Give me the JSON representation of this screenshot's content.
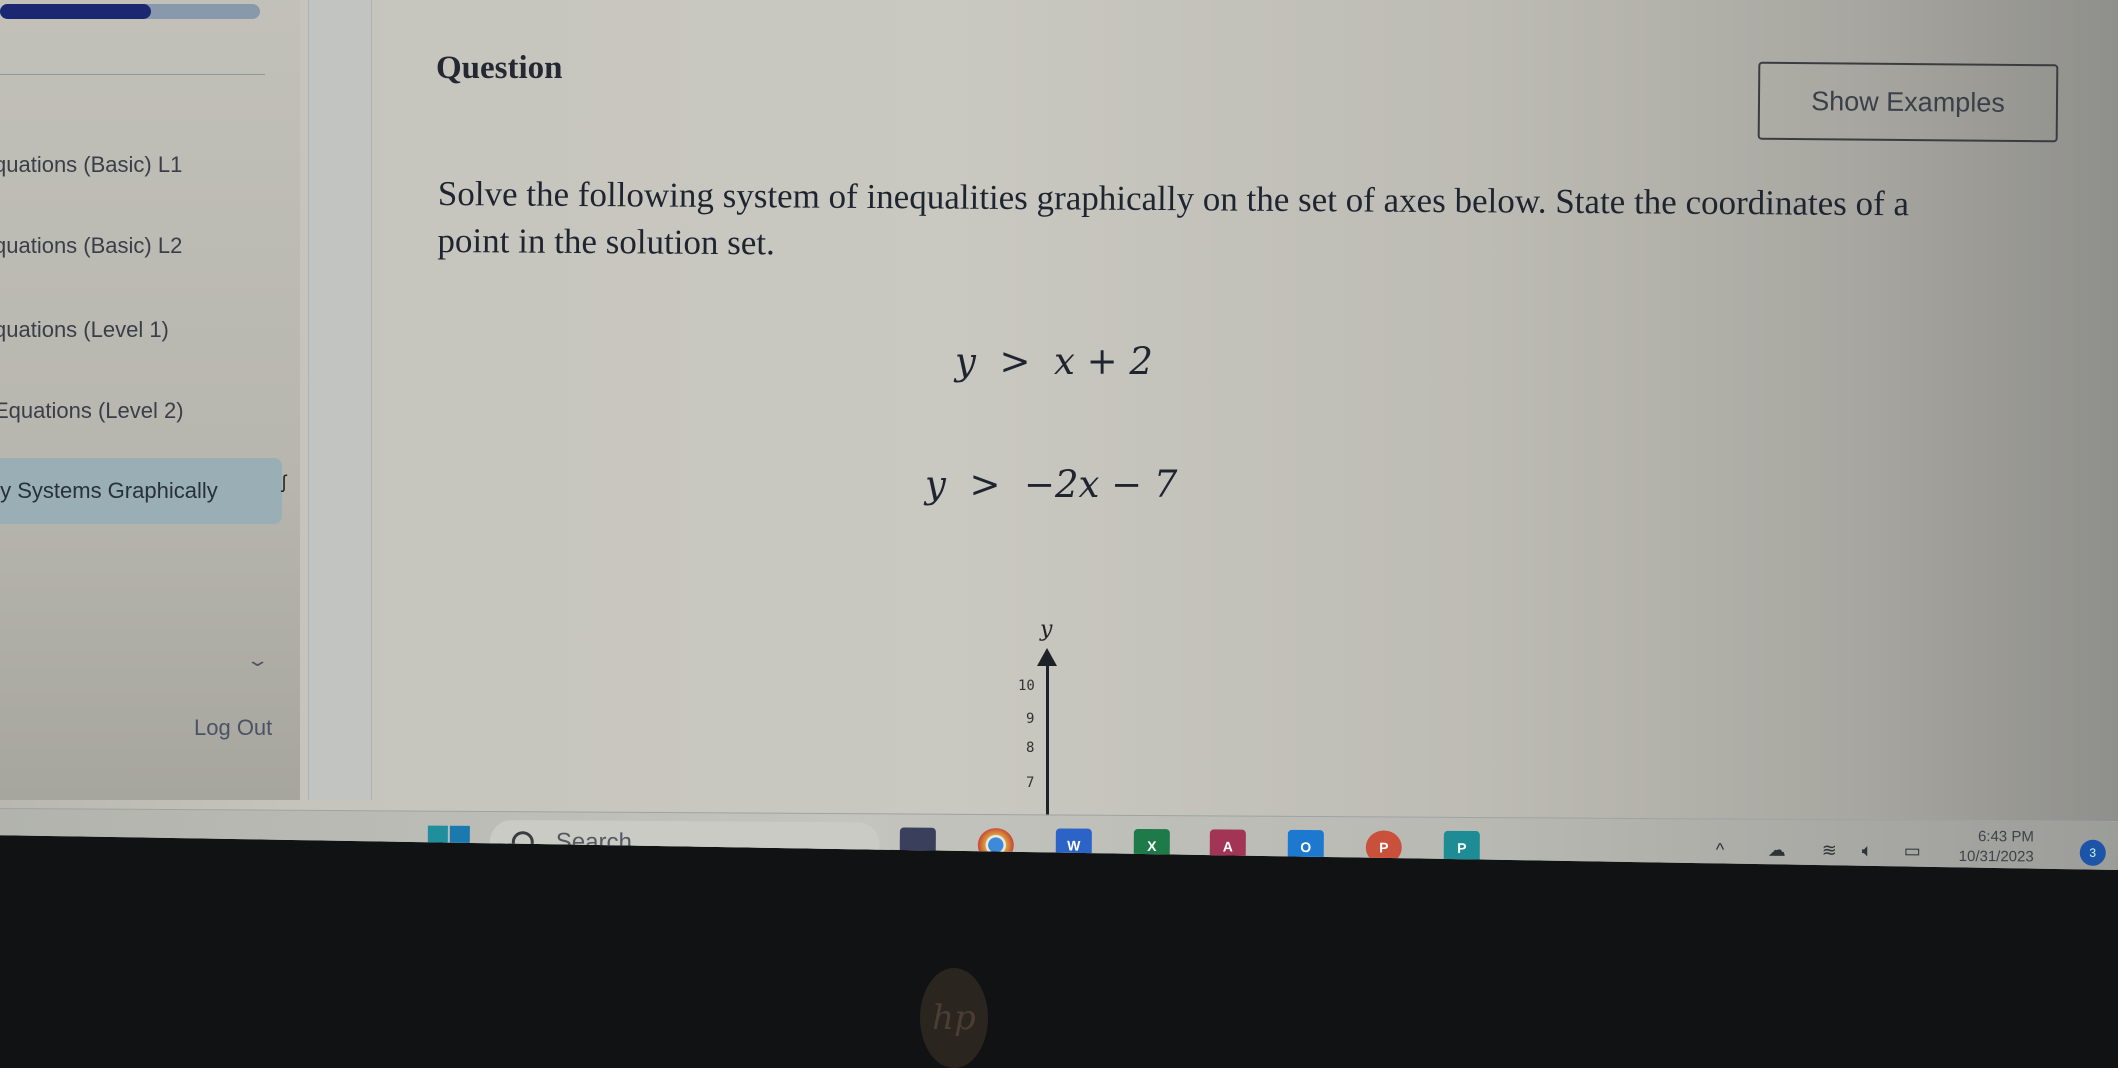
{
  "sidebar": {
    "progress_percent": 58,
    "items": [
      {
        "label": "quations (Basic) L1",
        "active": false
      },
      {
        "label": "quations (Basic) L2",
        "active": false
      },
      {
        "label": "quations (Level 1)",
        "active": false
      },
      {
        "label": "Equations (Level 2)",
        "active": false
      },
      {
        "label": "ty Systems Graphically",
        "active": true
      }
    ],
    "chevron": "chevron-down",
    "logout_label": "Log Out"
  },
  "main": {
    "title": "Question",
    "show_examples_label": "Show Examples",
    "prompt": "Solve the following system of inequalities graphically on the set of axes below. State the coordinates of a point in the solution set.",
    "inequalities": [
      {
        "lhs": "y",
        "op": ">",
        "rhs": "x + 2"
      },
      {
        "lhs": "y",
        "op": ">",
        "rhs": "−2x − 7"
      }
    ],
    "graph": {
      "y_axis_label": "y",
      "visible_y_ticks": [
        "10",
        "9",
        "8",
        "7"
      ]
    }
  },
  "taskbar": {
    "search_placeholder": "Search",
    "apps": [
      {
        "name": "task-view",
        "letter": "",
        "color": "#3a3f5c"
      },
      {
        "name": "chrome",
        "letter": "",
        "color": "#d9a13b",
        "running": true
      },
      {
        "name": "word",
        "letter": "W",
        "color": "#2b63c6"
      },
      {
        "name": "excel",
        "letter": "X",
        "color": "#1e7a48"
      },
      {
        "name": "access",
        "letter": "A",
        "color": "#a23556"
      },
      {
        "name": "outlook",
        "letter": "O",
        "color": "#1d79cf"
      },
      {
        "name": "powerpoint",
        "letter": "P",
        "color": "#c9503a"
      },
      {
        "name": "publisher",
        "letter": "P",
        "color": "#1d8c94"
      }
    ],
    "tray": {
      "overflow": "^",
      "time": "6:43 PM",
      "date": "10/31/2023",
      "notification_count": "3"
    }
  }
}
